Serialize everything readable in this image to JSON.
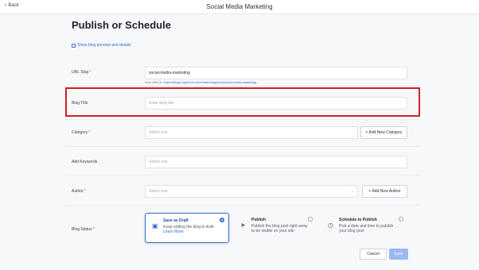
{
  "topbar": {
    "back_label": "Back",
    "title": "Social Media Marketing"
  },
  "page": {
    "title": "Publish or Schedule",
    "preview_link": "Show blog preview and details"
  },
  "fields": {
    "url_slug": {
      "label": "URL Slug",
      "value": "social-media-marketing",
      "hint_prefix": "Your URL is: ",
      "hint_link": "https://blogs.highlevel.com/marketing/post/social-media-marketing"
    },
    "blog_title": {
      "label": "Blog Title",
      "placeholder": "Enter blog title"
    },
    "category": {
      "label": "Category",
      "placeholder": "Select one",
      "add_button": "+ Add New Category"
    },
    "keywords": {
      "label": "Add Keywords",
      "placeholder": "Select one"
    },
    "author": {
      "label": "Author",
      "placeholder": "Select one",
      "add_button": "+ Add New Author"
    }
  },
  "blog_status": {
    "label": "Blog Status",
    "options": [
      {
        "title": "Save as Draft",
        "desc": "Keep editing the blog in draft",
        "extra": "Learn More"
      },
      {
        "title": "Publish",
        "desc": "Publish the blog post right away to be visible on your site"
      },
      {
        "title": "Schedule to Publish",
        "desc": "Pick a date and time to publish your blog post"
      }
    ]
  },
  "actions": {
    "cancel": "Cancel",
    "save": "Save"
  },
  "colors": {
    "accent": "#2f6fd6",
    "highlight": "#d21f25",
    "save_disabled": "#9db8ef"
  }
}
